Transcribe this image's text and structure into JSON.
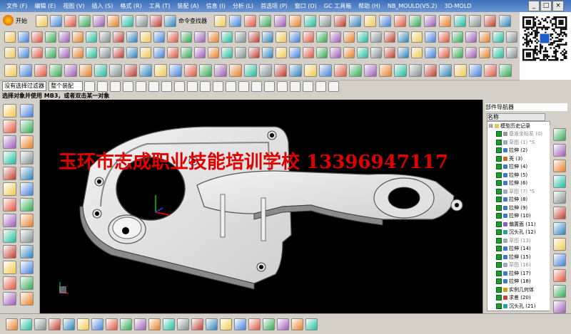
{
  "menu": {
    "items": [
      "文件 (F)",
      "编辑 (E)",
      "视图 (V)",
      "插入 (S)",
      "格式 (R)",
      "工具 (T)",
      "装配 (A)",
      "信息 (I)",
      "分析 (L)",
      "首选项 (P)",
      "窗口 (O)",
      "GC 工具箱",
      "帮助 (H)",
      "NB_MOULD(V5.2)",
      "3D-MOLD"
    ],
    "window_controls": [
      "_",
      "□",
      "×"
    ]
  },
  "toolbar": {
    "start_label": "开始",
    "command_finder_label": "命令查找器",
    "selection_filter": "没有选择过滤器",
    "assembly_scope": "整个装配"
  },
  "status": {
    "prompt": "选择对象并使用 MB3，或者双击某一对象"
  },
  "watermark": {
    "text": "玉环市志成职业技能培训学校  13396947117"
  },
  "navigator": {
    "title": "部件导航器",
    "column_name": "名称",
    "root": "模型历史记录",
    "items": [
      {
        "label": "基准坐标系",
        "num": "(0)",
        "icon": "csys",
        "checked": true,
        "dim": true
      },
      {
        "label": "草图",
        "num": "(1) \"S",
        "icon": "sketch",
        "checked": true,
        "dim": true
      },
      {
        "label": "拉伸",
        "num": "(2)",
        "icon": "extrude",
        "checked": true,
        "dim": false
      },
      {
        "label": "壳",
        "num": "(3)",
        "icon": "shell",
        "checked": true,
        "dim": false
      },
      {
        "label": "拉伸",
        "num": "(4)",
        "icon": "extrude",
        "checked": true,
        "dim": false
      },
      {
        "label": "拉伸",
        "num": "(5)",
        "icon": "extrude",
        "checked": true,
        "dim": false
      },
      {
        "label": "拉伸",
        "num": "(6)",
        "icon": "extrude",
        "checked": true,
        "dim": false
      },
      {
        "label": "草图",
        "num": "(7) \"S",
        "icon": "sketch",
        "checked": true,
        "dim": true
      },
      {
        "label": "拉伸",
        "num": "(8)",
        "icon": "extrude",
        "checked": true,
        "dim": false
      },
      {
        "label": "拉伸",
        "num": "(9)",
        "icon": "extrude",
        "checked": true,
        "dim": false
      },
      {
        "label": "拉伸",
        "num": "(10)",
        "icon": "extrude",
        "checked": true,
        "dim": false
      },
      {
        "label": "偏置面",
        "num": "(11)",
        "icon": "offset",
        "checked": true,
        "dim": false
      },
      {
        "label": "沉头孔",
        "num": "(12)",
        "icon": "hole",
        "checked": true,
        "dim": false
      },
      {
        "label": "草图",
        "num": "(13)",
        "icon": "sketch",
        "checked": true,
        "dim": true
      },
      {
        "label": "拉伸",
        "num": "(14)",
        "icon": "extrude",
        "checked": true,
        "dim": false
      },
      {
        "label": "拉伸",
        "num": "(15)",
        "icon": "extrude",
        "checked": true,
        "dim": false
      },
      {
        "label": "草图",
        "num": "(16)",
        "icon": "sketch",
        "checked": true,
        "dim": true
      },
      {
        "label": "拉伸",
        "num": "(17)",
        "icon": "extrude",
        "checked": true,
        "dim": false
      },
      {
        "label": "拉伸",
        "num": "(18)",
        "icon": "extrude",
        "checked": true,
        "dim": false
      },
      {
        "label": "实例几何体",
        "num": "",
        "icon": "instance",
        "checked": true,
        "dim": false
      },
      {
        "label": "求差",
        "num": "(20)",
        "icon": "subtract",
        "checked": true,
        "dim": false
      },
      {
        "label": "沉头孔",
        "num": "(21)",
        "icon": "hole",
        "checked": true,
        "dim": false
      }
    ]
  },
  "colors": {
    "menubar": "#4a7cc4",
    "viewport_bg": "#000000",
    "watermark": "#e00000",
    "part": "#e8e8e8",
    "check_green": "#1a9d2a"
  }
}
